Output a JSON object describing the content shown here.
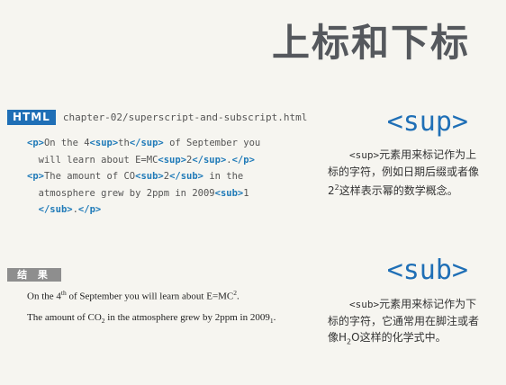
{
  "page": {
    "title": "上标和下标"
  },
  "code_panel": {
    "lang": "HTML",
    "file": "chapter-02/superscript-and-subscript.html",
    "lines": [
      [
        {
          "t": "<p>",
          "tag": true
        },
        {
          "t": "On the 4"
        },
        {
          "t": "<sup>",
          "tag": true
        },
        {
          "t": "th"
        },
        {
          "t": "</sup>",
          "tag": true
        },
        {
          "t": " of September you"
        }
      ],
      [
        {
          "t": "  will learn about E=MC"
        },
        {
          "t": "<sup>",
          "tag": true
        },
        {
          "t": "2"
        },
        {
          "t": "</sup>",
          "tag": true
        },
        {
          "t": "."
        },
        {
          "t": "</p>",
          "tag": true
        }
      ],
      [
        {
          "t": "<p>",
          "tag": true
        },
        {
          "t": "The amount of CO"
        },
        {
          "t": "<sub>",
          "tag": true
        },
        {
          "t": "2"
        },
        {
          "t": "</sub>",
          "tag": true
        },
        {
          "t": " in the"
        }
      ],
      [
        {
          "t": "  atmosphere grew by 2ppm in 2009"
        },
        {
          "t": "<sub>",
          "tag": true
        },
        {
          "t": "1"
        }
      ],
      [
        {
          "t": "  "
        },
        {
          "t": "</sub>",
          "tag": true
        },
        {
          "t": "."
        },
        {
          "t": "</p>",
          "tag": true
        }
      ]
    ]
  },
  "result": {
    "label": "结 果",
    "line1": {
      "a": "On the 4",
      "sup1": "th",
      "b": " of September you will learn about E=MC",
      "sup2": "2",
      "c": "."
    },
    "line2": {
      "a": "The amount of CO",
      "sub1": "2",
      "b": " in the atmosphere grew by 2ppm in 2009",
      "sub2": "1",
      "c": "."
    }
  },
  "sup_section": {
    "heading": "<sup>",
    "tag": "<sup>",
    "desc_a": "元素用来标记作为上标的字符，例如日期后缀或者像2",
    "desc_sup": "2",
    "desc_b": "这样表示幂的数学概念。"
  },
  "sub_section": {
    "heading": "<sub>",
    "tag": "<sub>",
    "desc_a": "元素用来标记作为下标的字符，它通常用在脚注或者像H",
    "desc_sub": "2",
    "desc_b": "O这样的化学式中。"
  }
}
